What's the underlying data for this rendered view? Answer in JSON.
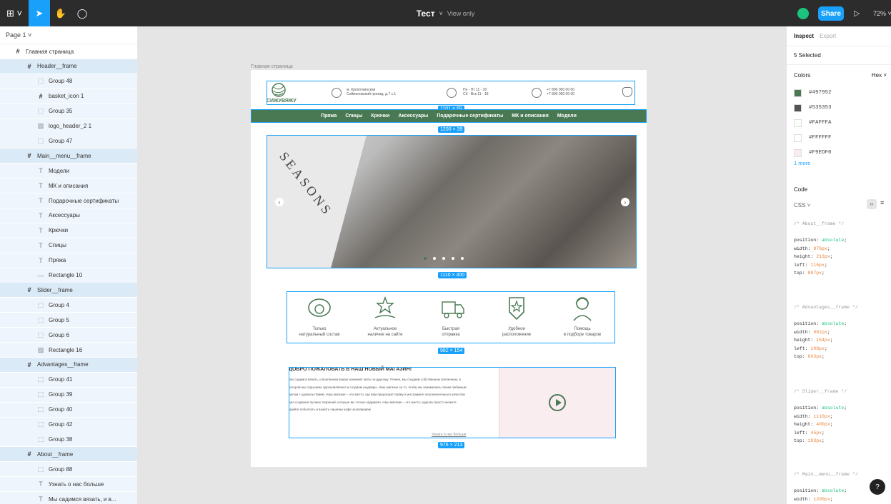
{
  "toolbar": {
    "file_title": "Тест",
    "view_mode": "View only",
    "share_label": "Share",
    "zoom": "72%"
  },
  "layers": {
    "page_selector": "Page 1",
    "items": [
      {
        "name": "Главная страница",
        "type": "frame",
        "level": 0
      },
      {
        "name": "Header__frame",
        "type": "frame",
        "level": 1
      },
      {
        "name": "Group 48",
        "type": "group",
        "level": 2
      },
      {
        "name": "basket_icon 1",
        "type": "frame",
        "level": 2
      },
      {
        "name": "Group 35",
        "type": "group",
        "level": 2
      },
      {
        "name": "logo_header_2 1",
        "type": "image",
        "level": 2
      },
      {
        "name": "Group 47",
        "type": "group",
        "level": 2
      },
      {
        "name": "Main__menu__frame",
        "type": "frame",
        "level": 1
      },
      {
        "name": "Модели",
        "type": "text",
        "level": 2
      },
      {
        "name": "МК и описания",
        "type": "text",
        "level": 2
      },
      {
        "name": "Подарочные сертификаты",
        "type": "text",
        "level": 2
      },
      {
        "name": "Аксессуары",
        "type": "text",
        "level": 2
      },
      {
        "name": "Крючки",
        "type": "text",
        "level": 2
      },
      {
        "name": "Спицы",
        "type": "text",
        "level": 2
      },
      {
        "name": "Пряжа",
        "type": "text",
        "level": 2
      },
      {
        "name": "Rectangle 10",
        "type": "line",
        "level": 2
      },
      {
        "name": "Slider__frame",
        "type": "frame",
        "level": 1
      },
      {
        "name": "Group 4",
        "type": "group",
        "level": 2
      },
      {
        "name": "Group 5",
        "type": "group",
        "level": 2
      },
      {
        "name": "Group 6",
        "type": "group",
        "level": 2
      },
      {
        "name": "Rectangle 16",
        "type": "image",
        "level": 2
      },
      {
        "name": "Advantages__frame",
        "type": "frame",
        "level": 1
      },
      {
        "name": "Group 41",
        "type": "group",
        "level": 2
      },
      {
        "name": "Group 39",
        "type": "group",
        "level": 2
      },
      {
        "name": "Group 40",
        "type": "group",
        "level": 2
      },
      {
        "name": "Group 42",
        "type": "group",
        "level": 2
      },
      {
        "name": "Group 38",
        "type": "group",
        "level": 2
      },
      {
        "name": "About__frame",
        "type": "frame",
        "level": 1
      },
      {
        "name": "Group 88",
        "type": "group",
        "level": 2
      },
      {
        "name": "Узнать о нас больше",
        "type": "text",
        "level": 2
      },
      {
        "name": "Мы садимся вязать, и в...",
        "type": "text",
        "level": 2
      }
    ]
  },
  "canvas": {
    "frame_label": "Главная страница",
    "dims": {
      "header": "1101 × 69",
      "menu": "1200 × 39",
      "slider": "1110 × 400",
      "advantages": "982 × 154",
      "about": "976 × 213"
    },
    "site": {
      "logo_text": "СИЖУВЯЖУ",
      "address": "м. Кропоткинская\nСоймоновский проезд, д.7 с.1",
      "hours": "Пн - Пт  11 - 20\nСб - Вск  11 - 18",
      "phones": "+7 800 000 00 00\n+7 800 000 00 00",
      "menu": [
        "Пряжа",
        "Спицы",
        "Крючки",
        "Аксессуары",
        "Подарочные сертификаты",
        "МК и описания",
        "Модели"
      ],
      "slider_text": "SEASONS",
      "advantages": [
        {
          "icon": "sheep-icon",
          "label": "Только\nнатуральный состав"
        },
        {
          "icon": "hand-star-icon",
          "label": "Актуальное\nналичие на сайте"
        },
        {
          "icon": "delivery-truck-icon",
          "label": "Быстрая\nотправка"
        },
        {
          "icon": "location-pin-icon",
          "label": "Удобное\nрасположение"
        },
        {
          "icon": "support-operator-icon",
          "label": "Помощь\nв подборе товаров"
        }
      ],
      "about_title": "ДОБРО ПОЖАЛОВАТЬ В НАШ НОВЫЙ МАГАЗИН!",
      "about_text": "Мы садимся вязать, и вселенная вокруг начинает жить по-другому. Точнее, мы создаем собственную вселенную, в которой мы отдыхаем, вдохновляемся и создаем шедевры. Наш магазин за то, чтобы вы занимались своим любимым делом с удовольствием. Наш магазин – это место, где вам предложат пряжу и инструмент исключительного качества для создания лучших творений, которые вы только задумали. Наш магазин – это место, куда вы просто можете прийти поболтать и выпить чашечку кофе за вязанием",
      "about_more": "Узнать о нас больше"
    }
  },
  "inspect": {
    "tab_inspect": "Inspect",
    "tab_export": "Export",
    "selection": "5 Selected",
    "colors_label": "Colors",
    "color_format": "Hex",
    "colors": [
      "#497952",
      "#535353",
      "#FAFFFA",
      "#FFFFFF",
      "#F9EDF0"
    ],
    "more_colors": "1 more",
    "code_label": "Code",
    "code_lang": "CSS",
    "code_blocks": [
      {
        "comment": "/* About__frame */",
        "lines": [
          [
            "position",
            "absolute"
          ],
          [
            "width",
            "976px"
          ],
          [
            "height",
            "213px"
          ],
          [
            "left",
            "115px"
          ],
          [
            "top",
            "887px"
          ]
        ]
      },
      {
        "comment": "/* Advantages__frame */",
        "lines": [
          [
            "position",
            "absolute"
          ],
          [
            "width",
            "982px"
          ],
          [
            "height",
            "154px"
          ],
          [
            "left",
            "108px"
          ],
          [
            "top",
            "663px"
          ]
        ]
      },
      {
        "comment": "/* Slider__frame */",
        "lines": [
          [
            "position",
            "absolute"
          ],
          [
            "width",
            "1110px"
          ],
          [
            "height",
            "400px"
          ],
          [
            "left",
            "45px"
          ],
          [
            "top",
            "193px"
          ]
        ]
      },
      {
        "comment": "/* Main__menu__frame */",
        "lines": [
          [
            "position",
            "absolute"
          ],
          [
            "width",
            "1200px"
          ]
        ]
      }
    ],
    "help": "?"
  }
}
